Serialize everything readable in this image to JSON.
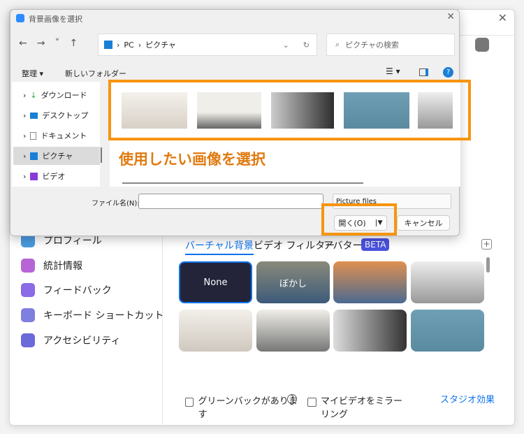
{
  "dialog": {
    "title": "背景画像を選択",
    "path": [
      "PC",
      "ピクチャ"
    ],
    "search_placeholder": "ピクチャの検索",
    "organize": "整理 ▾",
    "new_folder": "新しいフォルダー",
    "tree": [
      {
        "label": "ダウンロード",
        "color": "#2aa84a"
      },
      {
        "label": "デスクトップ",
        "color": "#1a7fd6"
      },
      {
        "label": "ドキュメント",
        "color": "#888"
      },
      {
        "label": "ピクチャ",
        "color": "#1a7fd6"
      },
      {
        "label": "ビデオ",
        "color": "#8a3ad6"
      }
    ],
    "annotation": "使用したい画像を選択",
    "filename_label": "ファイル名(N):",
    "filename_value": "",
    "filetype": "Picture files",
    "open": "開く(O)",
    "cancel": "キャンセル"
  },
  "sidebar": [
    {
      "label": "プロフィール",
      "color": "#4a9be0"
    },
    {
      "label": "統計情報",
      "color": "#b765d6"
    },
    {
      "label": "フィードバック",
      "color": "#8b6be6"
    },
    {
      "label": "キーボード ショートカット",
      "color": "#7f7fe0"
    },
    {
      "label": "アクセシビリティ",
      "color": "#6a6ad8"
    }
  ],
  "tabs": {
    "virtual": "バーチャル背景",
    "filter": "ビデオ フィルター",
    "avatar": "アバター",
    "beta": "BETA"
  },
  "backgrounds": [
    "None",
    "ぼかし",
    "",
    "",
    "",
    "",
    "",
    ""
  ],
  "footer": {
    "green": "グリーンバックがありま す",
    "mirror": "マイビデオをミラーリング",
    "studio": "スタジオ効果"
  },
  "colors": {
    "accent": "#0e72ed",
    "highlight": "#f7940f"
  }
}
